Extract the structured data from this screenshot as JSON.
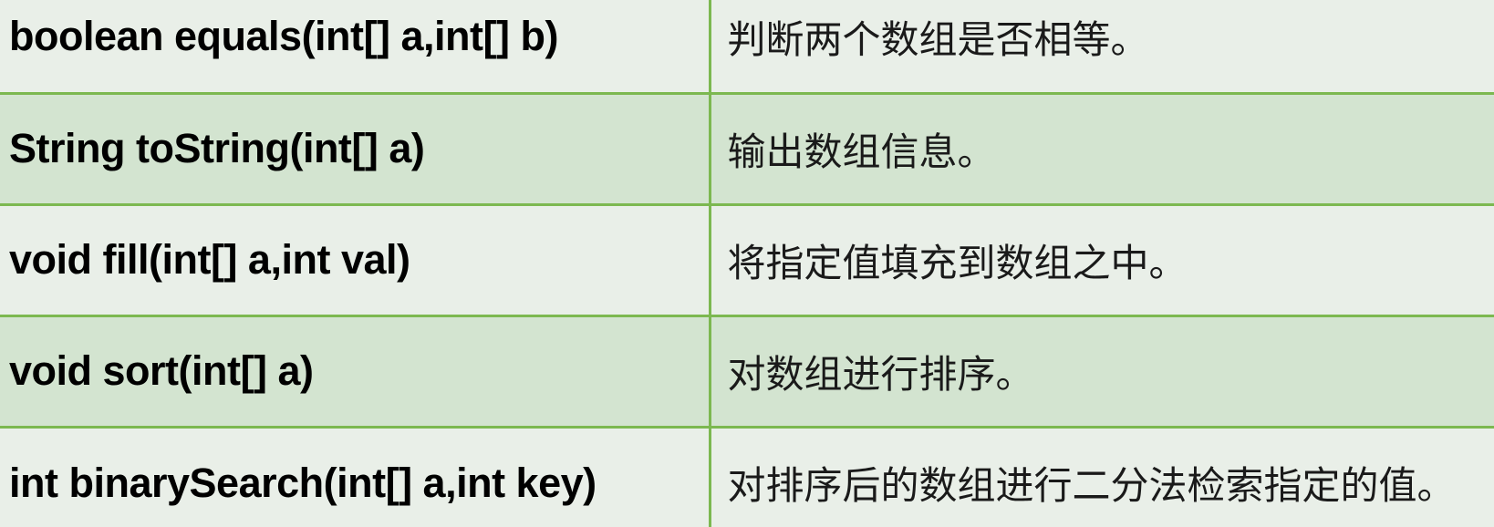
{
  "table": {
    "rows": [
      {
        "method": "boolean equals(int[] a,int[] b)",
        "description": "判断两个数组是否相等。"
      },
      {
        "method": "String toString(int[] a)",
        "description": "输出数组信息。"
      },
      {
        "method": "void fill(int[] a,int val)",
        "description": "将指定值填充到数组之中。"
      },
      {
        "method": "void sort(int[] a)",
        "description": "对数组进行排序。"
      },
      {
        "method": "int binarySearch(int[] a,int key)",
        "description": "对排序后的数组进行二分法检索指定的值。"
      }
    ]
  },
  "colors": {
    "row_light": "#e9efe8",
    "row_dark": "#d3e4d0",
    "border": "#7cb850"
  }
}
